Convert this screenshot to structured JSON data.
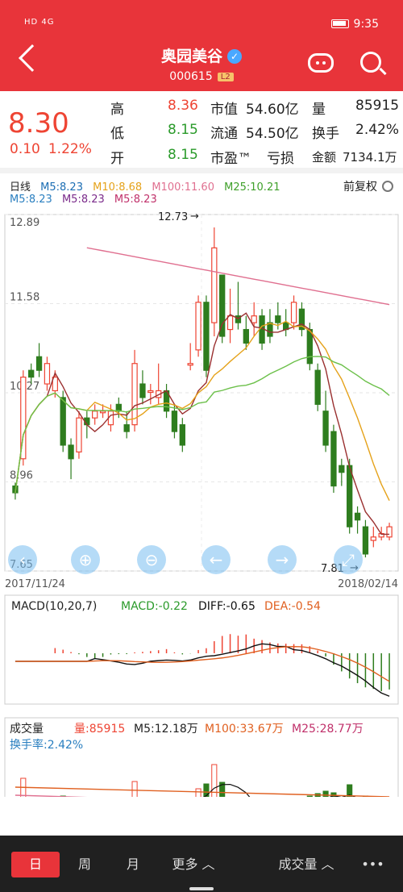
{
  "status": {
    "signal": "HD 4G",
    "time": "9:35"
  },
  "header": {
    "title": "奥园美谷",
    "code": "000615",
    "level_badge": "L2"
  },
  "quote": {
    "price": "8.30",
    "change": "0.10",
    "change_pct": "1.22%",
    "high_label": "高",
    "high": "8.36",
    "low_label": "低",
    "low": "8.15",
    "open_label": "开",
    "open": "8.15",
    "mktcap_label": "市值",
    "mktcap": "54.60亿",
    "float_label": "流通",
    "float": "54.50亿",
    "pe_label": "市盈™",
    "pe": "亏损",
    "vol_label": "量",
    "vol": "85915",
    "turnover_label": "换手",
    "turnover": "2.42%",
    "amount_label": "金额",
    "amount": "7134.1万"
  },
  "ma_legend": {
    "period": "日线",
    "m5": "M5:8.23",
    "m10": "M10:8.68",
    "m100": "M100:11.60",
    "m25": "M25:10.21",
    "m5b": "M5:8.23",
    "m5c": "M5:8.23",
    "m5d": "M5:8.23",
    "adjust": "前复权"
  },
  "colors": {
    "up": "#e43",
    "down": "#2e7d1e",
    "m5": "#9a3030",
    "m10": "#e5a21a",
    "m25": "#6cc04a",
    "m100": "#e07090",
    "macd": "#e06020",
    "diff": "#111111"
  },
  "chart_data": {
    "type": "candlestick",
    "price_labels": [
      "12.89",
      "11.58",
      "10.27",
      "8.96",
      "7.65"
    ],
    "ylim": [
      7.65,
      12.89
    ],
    "x_start": "2017/11/24",
    "x_end": "2018/02/14",
    "annotations": {
      "max": "12.73",
      "min": "7.81"
    },
    "candles": [
      [
        8.9,
        8.8,
        8.7,
        8.95
      ],
      [
        9.3,
        10.5,
        9.2,
        10.6
      ],
      [
        10.6,
        10.5,
        10.4,
        10.7
      ],
      [
        10.8,
        10.6,
        10.5,
        11.0
      ],
      [
        10.4,
        10.7,
        10.3,
        10.8
      ],
      [
        10.3,
        10.5,
        10.2,
        10.6
      ],
      [
        10.2,
        9.5,
        9.4,
        10.3
      ],
      [
        9.5,
        9.3,
        9.0,
        9.6
      ],
      [
        9.4,
        9.9,
        9.3,
        10.0
      ],
      [
        9.9,
        9.8,
        9.6,
        10.0
      ],
      [
        9.9,
        10.0,
        9.8,
        10.1
      ],
      [
        10.0,
        10.0,
        9.9,
        10.1
      ],
      [
        9.8,
        10.0,
        9.7,
        10.1
      ],
      [
        10.1,
        10.0,
        9.9,
        10.2
      ],
      [
        9.8,
        9.7,
        9.6,
        10.0
      ],
      [
        9.8,
        10.7,
        9.7,
        10.9
      ],
      [
        10.4,
        10.2,
        10.1,
        10.6
      ],
      [
        10.3,
        10.3,
        10.1,
        10.4
      ],
      [
        10.2,
        10.3,
        10.1,
        10.7
      ],
      [
        10.3,
        10.0,
        9.9,
        10.4
      ],
      [
        10.0,
        9.7,
        9.6,
        10.1
      ],
      [
        9.8,
        9.5,
        9.4,
        9.9
      ],
      [
        10.7,
        10.7,
        10.6,
        11.0
      ],
      [
        10.9,
        11.6,
        10.8,
        11.7
      ],
      [
        11.6,
        10.6,
        10.5,
        11.7
      ],
      [
        11.3,
        12.4,
        11.1,
        12.7
      ],
      [
        12.0,
        11.1,
        11.0,
        12.0
      ],
      [
        11.2,
        11.4,
        11.0,
        11.8
      ],
      [
        11.4,
        11.3,
        11.2,
        11.9
      ],
      [
        11.2,
        11.0,
        10.9,
        11.4
      ],
      [
        11.3,
        11.4,
        11.1,
        11.6
      ],
      [
        11.4,
        11.0,
        10.9,
        11.5
      ],
      [
        11.3,
        11.1,
        11.0,
        11.5
      ],
      [
        11.4,
        11.3,
        11.2,
        11.6
      ],
      [
        11.3,
        11.2,
        11.1,
        11.5
      ],
      [
        11.3,
        11.6,
        11.2,
        11.7
      ],
      [
        11.5,
        11.2,
        11.1,
        11.6
      ],
      [
        11.2,
        10.7,
        10.6,
        11.3
      ],
      [
        10.6,
        10.1,
        10.0,
        10.7
      ],
      [
        10.0,
        9.5,
        9.4,
        10.3
      ],
      [
        9.7,
        8.9,
        8.8,
        9.8
      ],
      [
        9.2,
        9.1,
        8.9,
        9.3
      ],
      [
        9.2,
        8.3,
        8.2,
        9.3
      ],
      [
        8.5,
        8.4,
        8.2,
        8.6
      ],
      [
        8.3,
        7.9,
        7.85,
        8.4
      ],
      [
        8.1,
        8.15,
        8.0,
        8.3
      ],
      [
        8.15,
        8.2,
        8.1,
        8.3
      ],
      [
        8.15,
        8.3,
        8.1,
        8.36
      ]
    ],
    "macd_panel": {
      "title": "MACD(10,20,7)",
      "macd": "MACD:-0.22",
      "diff": "DIFF:-0.65",
      "dea": "DEA:-0.54"
    },
    "volume_panel": {
      "title": "成交量",
      "vol": "量:85915",
      "m5": "M5:12.18万",
      "m100": "M100:33.67万",
      "m25": "M25:28.77万",
      "turnover": "换手率:2.42%"
    }
  },
  "tabs": [
    "日",
    "周",
    "月",
    "更多 ︿",
    "成交量 ︿",
    "•••"
  ]
}
